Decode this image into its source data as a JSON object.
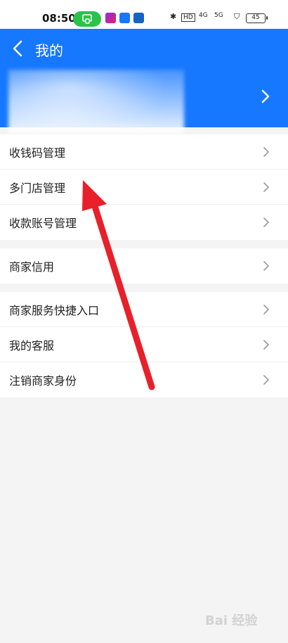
{
  "status_bar": {
    "time": "08:50",
    "hd": "HD",
    "net": "4G",
    "net2": "5G",
    "battery": "45"
  },
  "header": {
    "title": "我的"
  },
  "menu": {
    "group1": [
      {
        "label": "收钱码管理"
      },
      {
        "label": "多门店管理"
      },
      {
        "label": "收款账号管理"
      }
    ],
    "group2": [
      {
        "label": "商家信用"
      }
    ],
    "group3": [
      {
        "label": "商家服务快捷入口"
      },
      {
        "label": "我的客服"
      },
      {
        "label": "注销商家身份"
      }
    ]
  },
  "colors": {
    "header_bg": "#1677ff",
    "page_bg": "#f4f4f4",
    "arrow": "#e8202a"
  },
  "watermark": {
    "text": "Bai 经验"
  }
}
